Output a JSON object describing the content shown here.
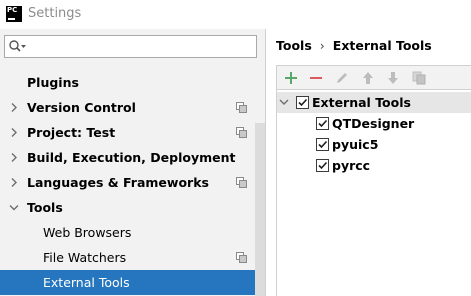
{
  "window": {
    "logo_text": "PC",
    "title": "Settings"
  },
  "search": {
    "placeholder": "",
    "value": ""
  },
  "sidebar": {
    "items": [
      {
        "label": "Plugins",
        "expandable": false,
        "has_copy_icon": false
      },
      {
        "label": "Version Control",
        "expandable": true,
        "has_copy_icon": true
      },
      {
        "label": "Project: Test",
        "expandable": true,
        "has_copy_icon": true
      },
      {
        "label": "Build, Execution, Deployment",
        "expandable": true,
        "has_copy_icon": false
      },
      {
        "label": "Languages & Frameworks",
        "expandable": true,
        "has_copy_icon": true
      },
      {
        "label": "Tools",
        "expandable": true,
        "expanded": true,
        "has_copy_icon": false
      },
      {
        "label": "Web Browsers",
        "child": true,
        "has_copy_icon": false
      },
      {
        "label": "File Watchers",
        "child": true,
        "has_copy_icon": true
      },
      {
        "label": "External Tools",
        "child": true,
        "selected": true,
        "has_copy_icon": false
      }
    ]
  },
  "breadcrumb": {
    "parent": "Tools",
    "separator": "›",
    "current": "External Tools"
  },
  "toolbar": {
    "buttons": [
      "add-icon",
      "remove-icon",
      "edit-icon",
      "move-up-icon",
      "move-down-icon",
      "copy-icon"
    ]
  },
  "tools_tree": {
    "group": {
      "label": "External Tools",
      "checked": true,
      "expanded": true
    },
    "items": [
      {
        "label": "QTDesigner",
        "checked": true
      },
      {
        "label": "pyuic5",
        "checked": true
      },
      {
        "label": "pyrcc",
        "checked": true
      }
    ]
  },
  "colors": {
    "selection": "#2675bf",
    "sidebar_bg": "#f2f2f2",
    "add_green": "#59a869",
    "remove_red": "#db5860"
  }
}
